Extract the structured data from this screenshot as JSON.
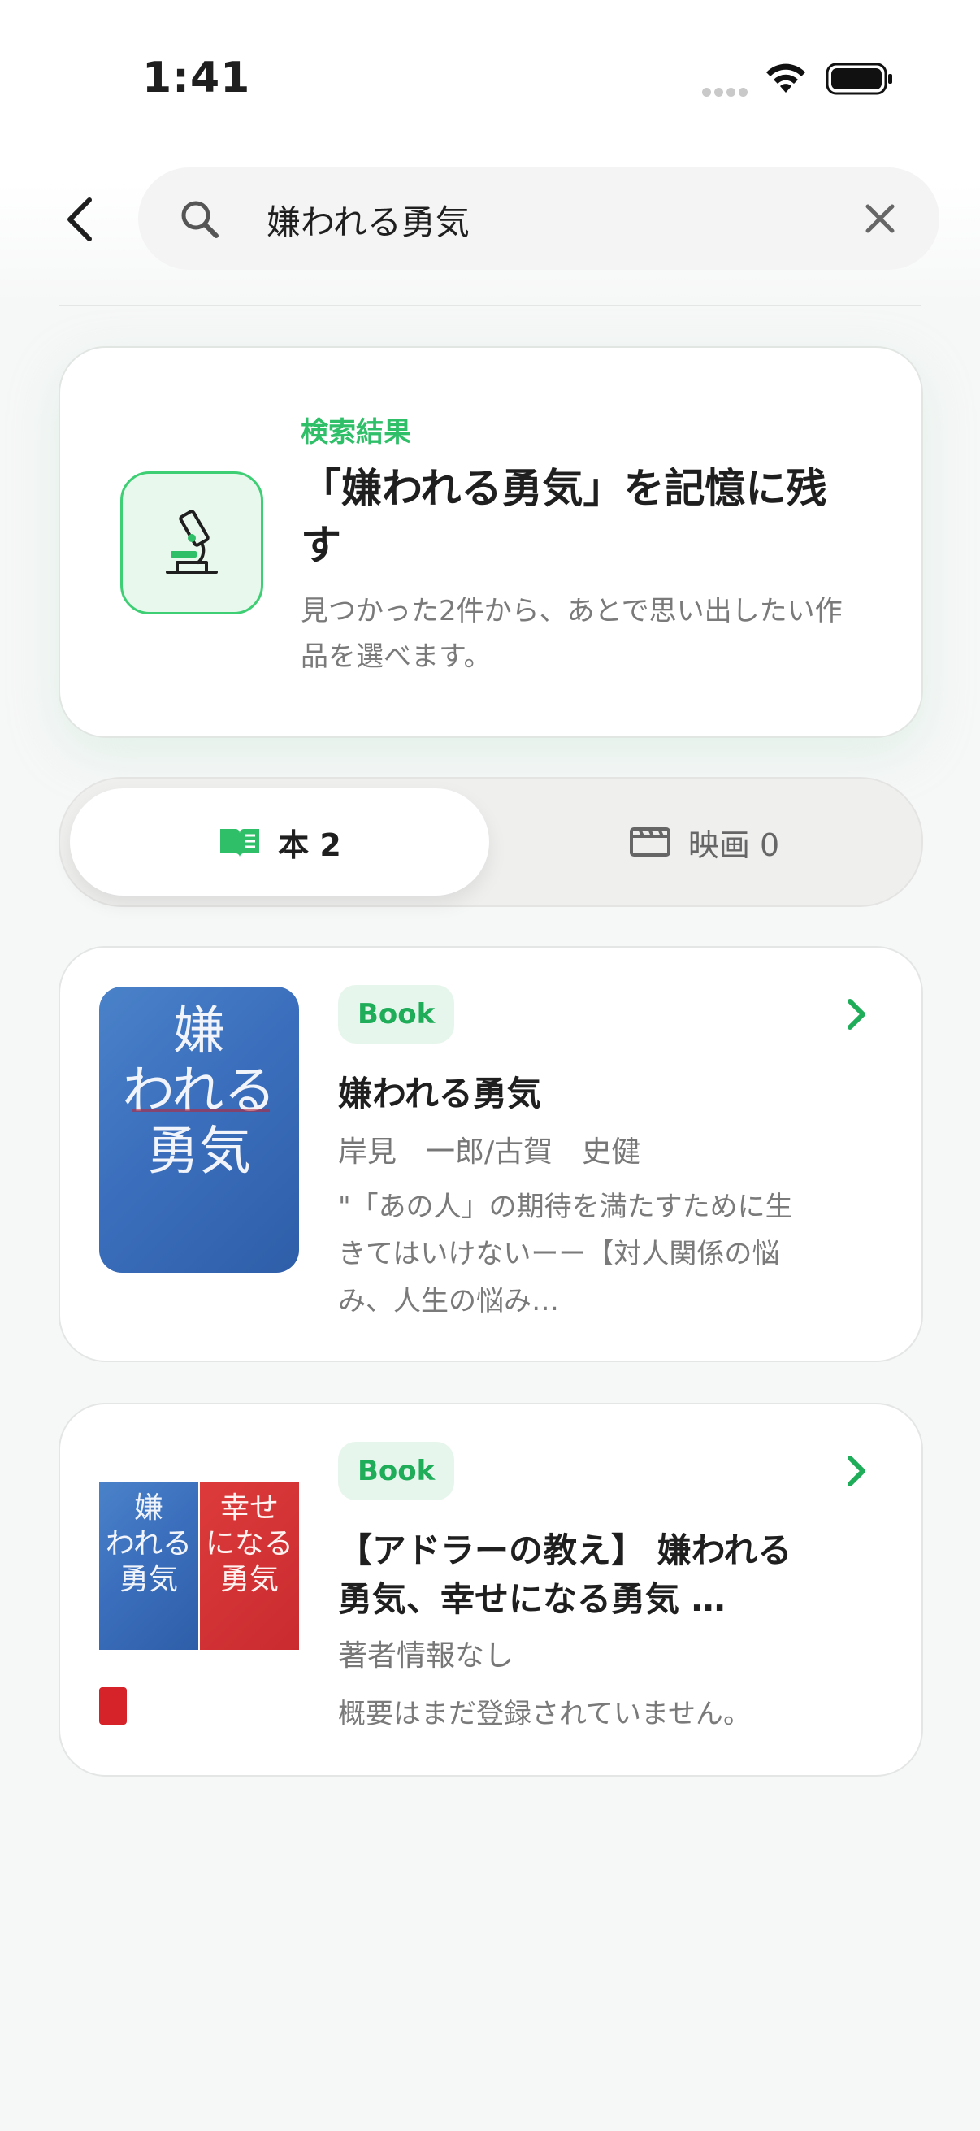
{
  "status": {
    "time": "1:41"
  },
  "search": {
    "query": "嫌われる勇気"
  },
  "hero": {
    "eyebrow": "検索結果",
    "title": "「嫌われる勇気」を記憶に残す",
    "description": "見つかった2件から、あとで思い出したい作品を選べます。"
  },
  "tabs": [
    {
      "label": "本 2",
      "active": true,
      "icon": "book-icon"
    },
    {
      "label": "映画 0",
      "active": false,
      "icon": "clapperboard-icon"
    }
  ],
  "results": [
    {
      "badge": "Book",
      "title": "嫌われる勇気",
      "author": "岸見　一郎/古賀　史健",
      "summary": "\"「あの人」の期待を満たすために生きてはいけないーー【対人関係の悩み、人生の悩み…",
      "cover_text": [
        "嫌",
        "われる",
        "勇気"
      ]
    },
    {
      "badge": "Book",
      "title": "【アドラーの教え】 嫌われる勇気、幸せになる勇気 …",
      "author": "著者情報なし",
      "summary": "概要はまだ登録されていません。",
      "cover_left_text": [
        "嫌",
        "われる",
        "勇気"
      ],
      "cover_right_text": [
        "幸せ",
        "になる",
        "勇気"
      ]
    }
  ],
  "colors": {
    "accent": "#2fbf68",
    "background": "#f6f7f7"
  }
}
